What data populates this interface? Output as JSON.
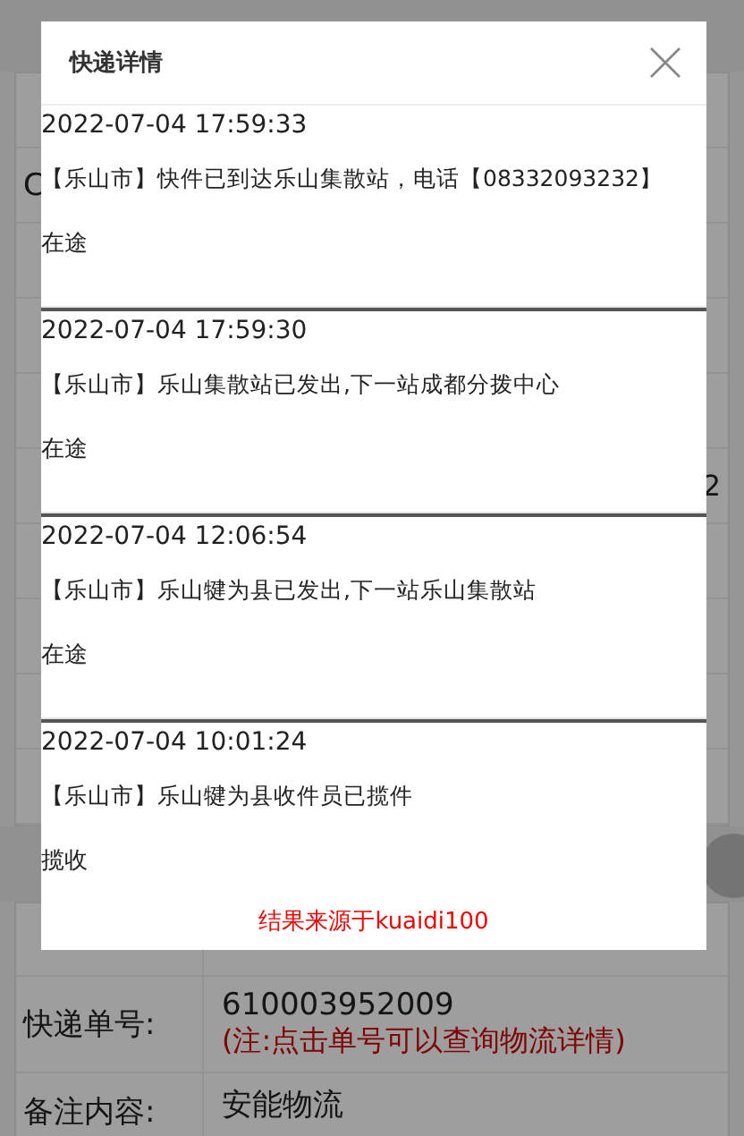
{
  "page": {
    "rows": [
      {},
      {
        "label": "C"
      },
      {},
      {},
      {},
      {
        "value": "2"
      },
      {},
      {},
      {},
      {}
    ],
    "detail_rows": [
      {},
      {
        "label": "快递单号:",
        "value": "610003952009",
        "note": "(注:点击单号可以查询物流详情)"
      },
      {
        "label": "备注内容:",
        "value": "安能物流"
      }
    ]
  },
  "dialog": {
    "title": "快递详情",
    "items": [
      {
        "time": "2022-07-04 17:59:33",
        "context": "【乐山市】快件已到达乐山集散站，电话【08332093232】",
        "status": "在途"
      },
      {
        "time": "2022-07-04 17:59:30",
        "context": "【乐山市】乐山集散站已发出,下一站成都分拨中心",
        "status": "在途"
      },
      {
        "time": "2022-07-04 12:06:54",
        "context": "【乐山市】乐山犍为县已发出,下一站乐山集散站",
        "status": "在途"
      },
      {
        "time": "2022-07-04 10:01:24",
        "context": "【乐山市】乐山犍为县收件员已揽件",
        "status": "揽收"
      }
    ],
    "footer": "结果来源于kuaidi100"
  }
}
